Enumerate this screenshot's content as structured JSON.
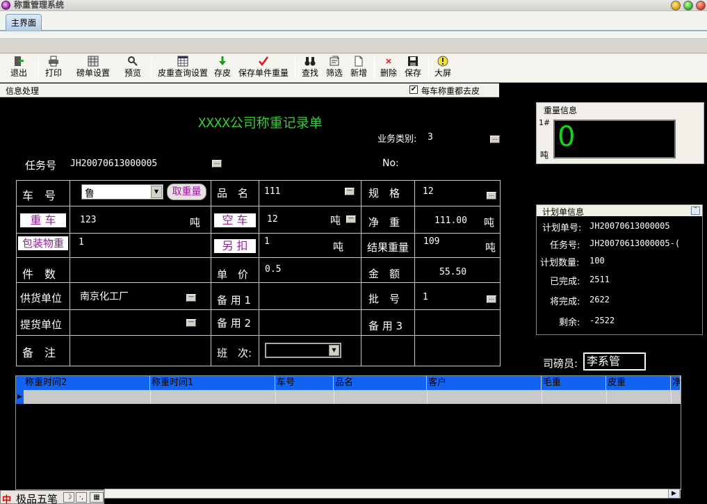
{
  "window": {
    "title": "称重管理系统"
  },
  "tabs": [
    {
      "label": "主界面"
    }
  ],
  "toolbar": {
    "items": [
      {
        "label": "退出",
        "icon": "exit-icon"
      },
      {
        "label": "打印",
        "icon": "printer-icon"
      },
      {
        "label": "磅单设置",
        "icon": "grid-settings-icon"
      },
      {
        "label": "预览",
        "icon": "preview-icon"
      },
      {
        "label": "皮重查询设置",
        "icon": "calendar-grid-icon"
      },
      {
        "label": "存皮",
        "icon": "down-arrow-icon"
      },
      {
        "label": "保存单件重量",
        "icon": "checkmark-icon"
      },
      {
        "label": "查找",
        "icon": "binoculars-icon"
      },
      {
        "label": "筛选",
        "icon": "filter-icon"
      },
      {
        "label": "新增",
        "icon": "new-document-icon"
      },
      {
        "label": "删除",
        "icon": "delete-x-icon"
      },
      {
        "label": "保存",
        "icon": "floppy-disk-icon"
      },
      {
        "label": "大屏",
        "icon": "big-screen-icon"
      }
    ]
  },
  "infobar": {
    "label": "信息处理",
    "checkbox_label": "每车称重都去皮",
    "checked": true
  },
  "form": {
    "title": "XXXX公司称重记录单",
    "business_type_label": "业务类别:",
    "business_type_value": "3",
    "task_no_label": "任务号",
    "task_no_value": "JH20070613000005",
    "no_label": "No:",
    "rows": {
      "plate_label": "车　号",
      "plate_value": "鲁",
      "fetch_weight_button": "取重量",
      "product_label": "品　名",
      "product_value": "111",
      "spec_label": "规　格",
      "spec_value": "12",
      "gross_label": "重 车",
      "gross_value": "123",
      "gross_unit": "吨",
      "tare_label": "空 车",
      "tare_value": "12",
      "tare_unit": "吨",
      "net_label": "净　重",
      "net_value": "111.00",
      "net_unit": "吨",
      "package_label": "包装物重",
      "package_value": "1",
      "deduct_label": "另 扣",
      "deduct_value": "1",
      "deduct_unit": "吨",
      "result_label": "结果重量",
      "result_value": "109",
      "result_unit": "吨",
      "pieces_label": "件　数",
      "pieces_value": "",
      "price_label": "单　价",
      "price_value": "0.5",
      "amount_label": "金　额",
      "amount_value": "55.50",
      "supplier_label": "供货单位",
      "supplier_value": "南京化工厂",
      "spare1_label": "备 用 1",
      "spare1_value": "",
      "batch_label": "批　号",
      "batch_value": "1",
      "pickup_label": "提货单位",
      "pickup_value": "",
      "spare2_label": "备 用 2",
      "spare2_value": "",
      "spare3_label": "备 用 3",
      "spare3_value": "",
      "remark_label": "备　注",
      "remark_value": "",
      "shift_label": "班　次:",
      "shift_value": ""
    }
  },
  "weight_panel": {
    "title": "重量信息",
    "scale_label": "1#",
    "unit": "吨",
    "value": "0"
  },
  "plan_panel": {
    "title": "计划单信息",
    "plan_no_label": "计划单号:",
    "plan_no_value": "JH20070613000005",
    "task_no_label": "任务号:",
    "task_no_value": "JH20070613000005-(",
    "plan_qty_label": "计划数量:",
    "plan_qty_value": "100",
    "done_label": "已完成:",
    "done_value": "2511",
    "will_done_label": "将完成:",
    "will_done_value": "2622",
    "remain_label": "剩余:",
    "remain_value": "-2522"
  },
  "operator": {
    "label": "司磅员:",
    "value": "李系管"
  },
  "table": {
    "columns": [
      "称重时间2",
      "称重时间1",
      "车号",
      "品名",
      "客户",
      "毛重",
      "皮重",
      "净"
    ]
  },
  "ime": {
    "name": "极品五笔",
    "icon": "ime-logo-icon"
  },
  "colors": {
    "title_green": "#2fd12f",
    "label_magenta": "#9a1aa0",
    "header_blue": "#1064f0",
    "weight_green": "#14d314"
  }
}
